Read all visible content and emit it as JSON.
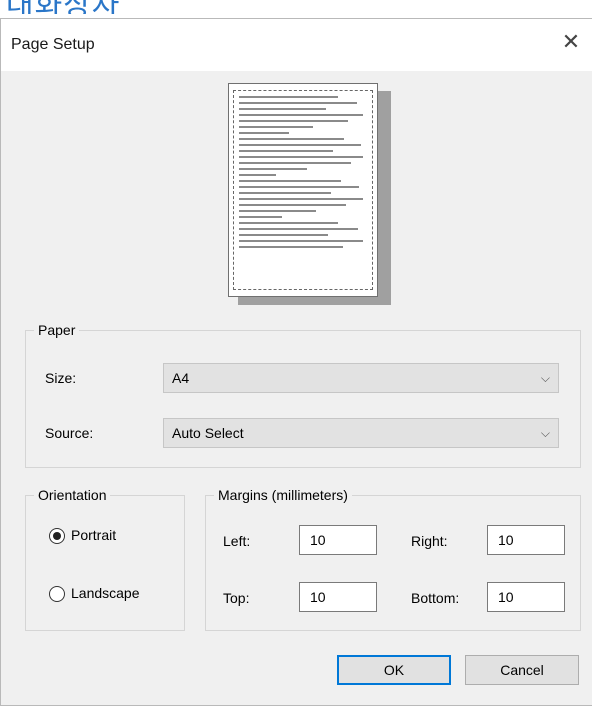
{
  "background": {
    "partial_text": "대화상자"
  },
  "window": {
    "title": "Page Setup",
    "close_glyph": "✕"
  },
  "paper": {
    "group_label": "Paper",
    "size_label": "Size:",
    "size_value": "A4",
    "source_label": "Source:",
    "source_value": "Auto Select"
  },
  "orientation": {
    "group_label": "Orientation",
    "portrait_label": "Portrait",
    "landscape_label": "Landscape",
    "selected": "Portrait"
  },
  "margins": {
    "group_label": "Margins (millimeters)",
    "left_label": "Left:",
    "left_value": "10",
    "right_label": "Right:",
    "right_value": "10",
    "top_label": "Top:",
    "top_value": "10",
    "bottom_label": "Bottom:",
    "bottom_value": "10"
  },
  "buttons": {
    "ok": "OK",
    "cancel": "Cancel"
  },
  "colors": {
    "accent": "#0078d7",
    "dialog_bg": "#f0f0f0",
    "background_text": "#2a76c8"
  }
}
